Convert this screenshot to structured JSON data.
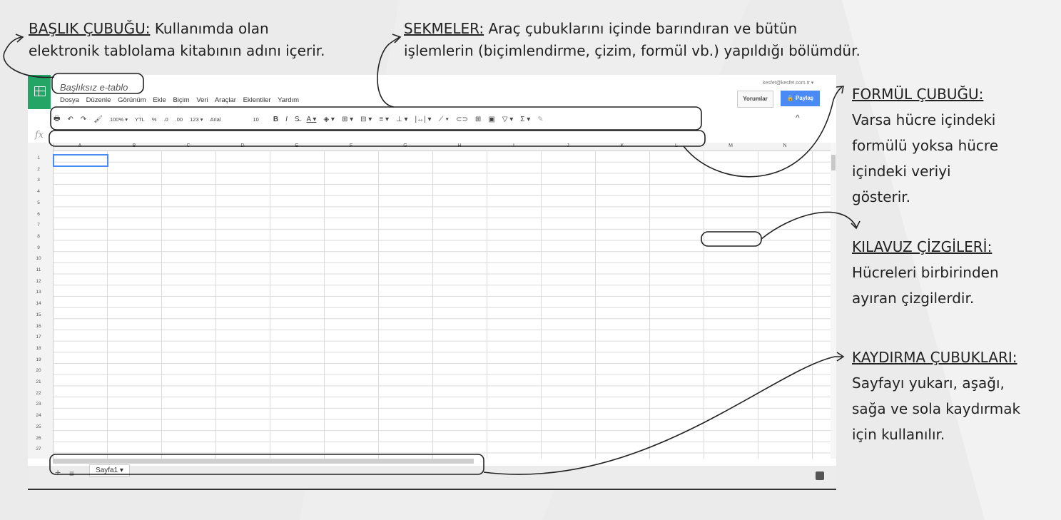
{
  "annotations": {
    "title_bar": {
      "heading": "BAŞLIK ÇUBUĞU:",
      "line1": "Kullanımda olan",
      "line2": "elektronik tablolama kitabının adını içerir."
    },
    "tabs": {
      "heading": "SEKMELER:",
      "line1": "Araç çubuklarını içinde barındıran ve bütün",
      "line2": "işlemlerin (biçimlendirme, çizim, formül vb.) yapıldığı bölümdür."
    },
    "formula_bar": {
      "heading": "FORMÜL ÇUBUĞU:",
      "lines": [
        "Varsa hücre içindeki",
        "formülü yoksa hücre",
        "içindeki veriyi",
        "gösterir."
      ]
    },
    "gridlines": {
      "heading": "KILAVUZ ÇİZGİLERİ:",
      "lines": [
        "Hücreleri birbirinden",
        "ayıran çizgilerdir."
      ]
    },
    "scrollbars": {
      "heading": "KAYDIRMA ÇUBUKLARI:",
      "lines": [
        "Sayfayı yukarı, aşağı,",
        "sağa ve sola kaydırmak",
        "için kullanılır."
      ]
    }
  },
  "spreadsheet": {
    "title": "Başlıksız e-tablo",
    "menu": [
      "Dosya",
      "Düzenle",
      "Görünüm",
      "Ekle",
      "Biçim",
      "Veri",
      "Araçlar",
      "Eklentiler",
      "Yardım"
    ],
    "account": "kesfet@kesfet.com.tr ▾",
    "comments_button": "Yorumlar",
    "share_button": "🔒 Paylaş",
    "toolbar": {
      "icons": [
        "🖶",
        "↶",
        "↷",
        "🖌"
      ],
      "zoom": "100% ▾",
      "currency": "YTL",
      "percent": "%",
      "dec_less": ".0",
      "dec_more": ".00",
      "number_format": "123 ▾",
      "font": "Arial",
      "font_size": "10",
      "format_icons": [
        "B",
        "I",
        "S̶",
        "A ▾",
        "◈ ▾",
        "⊞ ▾",
        "⊟ ▾",
        "≡ ▾",
        "⊥ ▾",
        "|↔| ▾",
        "⟋ ▾",
        "⊂⊃",
        "⊞",
        "▣",
        "▽ ▾",
        "Σ ▾",
        "✎"
      ]
    },
    "fx_label": "fx",
    "columns": [
      "A",
      "B",
      "C",
      "D",
      "E",
      "F",
      "G",
      "H",
      "I",
      "J",
      "K",
      "L",
      "M",
      "N"
    ],
    "rows": [
      "1",
      "2",
      "3",
      "4",
      "5",
      "6",
      "7",
      "8",
      "9",
      "10",
      "11",
      "12",
      "13",
      "14",
      "15",
      "16",
      "17",
      "18",
      "19",
      "20",
      "21",
      "22",
      "23",
      "24",
      "25",
      "26",
      "27"
    ],
    "sheet_tab": "Sayfa1 ▾",
    "add_sheet": "+",
    "all_sheets": "≡"
  }
}
